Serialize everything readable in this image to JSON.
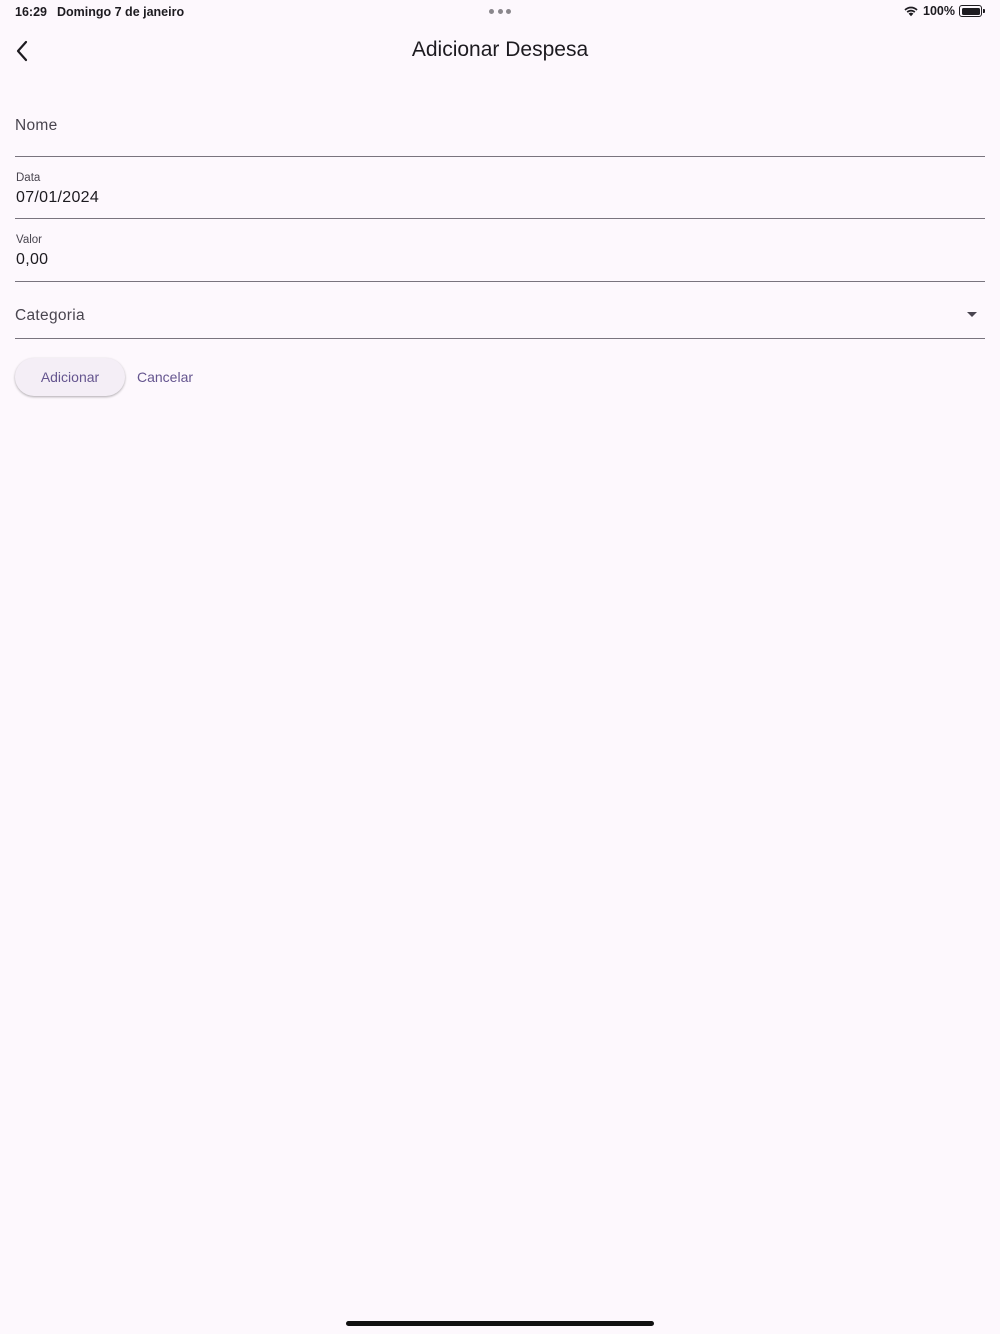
{
  "status_bar": {
    "time": "16:29",
    "date": "Domingo 7 de janeiro",
    "battery": "100%"
  },
  "app_bar": {
    "title": "Adicionar Despesa",
    "back_icon": "chevron-left-icon"
  },
  "form": {
    "nome": {
      "placeholder": "Nome",
      "value": ""
    },
    "data": {
      "label": "Data",
      "value": "07/01/2024"
    },
    "valor": {
      "label": "Valor",
      "value": "0,00"
    },
    "categoria": {
      "placeholder": "Categoria",
      "icon": "dropdown-arrow-icon"
    }
  },
  "actions": {
    "add_label": "Adicionar",
    "cancel_label": "Cancelar"
  },
  "colors": {
    "background": "#fdf8fd",
    "primary": "#65558f",
    "button_bg": "#f4eef6"
  }
}
